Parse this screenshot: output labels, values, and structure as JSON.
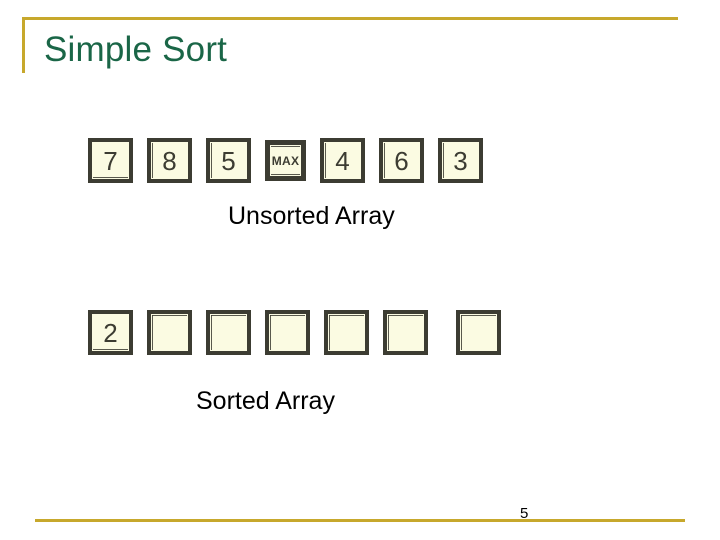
{
  "slide": {
    "title": "Simple Sort",
    "page_number": "5",
    "accent_color": "#c7a82c",
    "title_color": "#1a6647",
    "cell_fill_color": "#fbfbe2",
    "cell_border_color": "#3c3c32"
  },
  "unsorted": {
    "caption": "Unsorted Array",
    "cells": [
      {
        "value": "7",
        "kind": "value"
      },
      {
        "value": "8",
        "kind": "value"
      },
      {
        "value": "5",
        "kind": "value"
      },
      {
        "value": "MAX",
        "kind": "marker"
      },
      {
        "value": "4",
        "kind": "value"
      },
      {
        "value": "6",
        "kind": "value"
      },
      {
        "value": "3",
        "kind": "value"
      }
    ]
  },
  "sorted": {
    "caption": "Sorted Array",
    "cells": [
      {
        "value": "2",
        "kind": "value"
      },
      {
        "value": "",
        "kind": "empty"
      },
      {
        "value": "",
        "kind": "empty"
      },
      {
        "value": "",
        "kind": "empty"
      },
      {
        "value": "",
        "kind": "empty"
      },
      {
        "value": "",
        "kind": "empty"
      },
      {
        "value": "",
        "kind": "empty"
      }
    ]
  }
}
